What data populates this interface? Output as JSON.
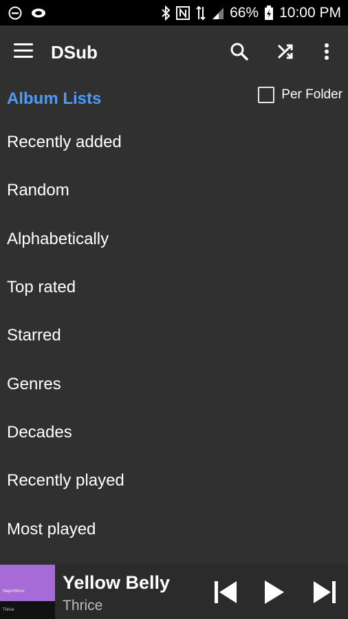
{
  "status_bar": {
    "battery": "66%",
    "time": "10:00 PM"
  },
  "toolbar": {
    "title": "DSub"
  },
  "section": {
    "title": "Album Lists",
    "per_folder_label": "Per Folder",
    "per_folder_checked": false
  },
  "list": {
    "items": [
      "Recently added",
      "Random",
      "Alphabetically",
      "Top rated",
      "Starred",
      "Genres",
      "Decades",
      "Recently played",
      "Most played"
    ]
  },
  "now_playing": {
    "title": "Yellow Belly",
    "artist": "Thrice",
    "art_text_top": "Major/Minor",
    "art_text_bottom": "Thrice"
  },
  "colors": {
    "background": "#303030",
    "accent": "#4f9bf3",
    "status_bar": "#000000"
  }
}
